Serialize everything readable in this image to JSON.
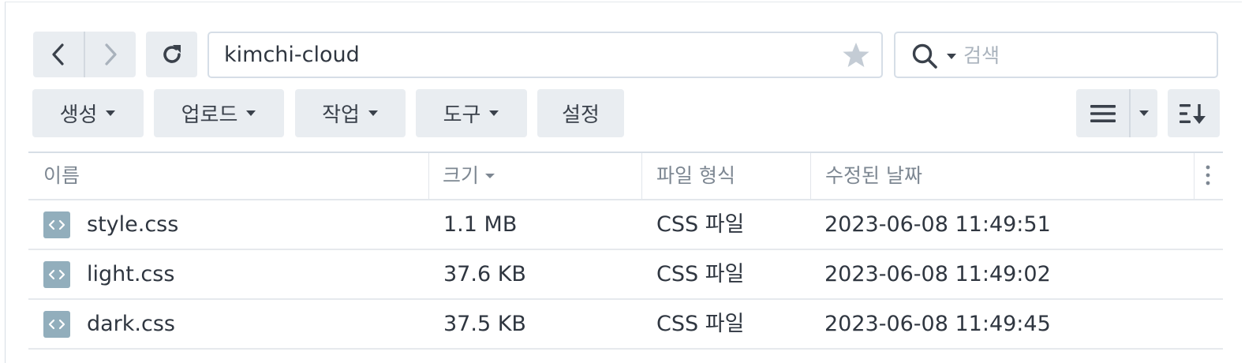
{
  "navigation": {
    "back_icon": "chevron-left-icon",
    "forward_icon": "chevron-right-icon",
    "refresh_icon": "refresh-icon"
  },
  "path_bar": {
    "value": "kimchi-cloud",
    "favorite_icon": "star-icon"
  },
  "search": {
    "placeholder": "검색",
    "icon": "search-icon"
  },
  "toolbar": {
    "create_label": "생성",
    "upload_label": "업로드",
    "action_label": "작업",
    "tools_label": "도구",
    "settings_label": "설정",
    "view_icon": "list-view-icon",
    "sort_icon": "sort-icon"
  },
  "table": {
    "columns": {
      "name": "이름",
      "size": "크기",
      "type": "파일 형식",
      "modified": "수정된 날짜"
    },
    "sorted_by": "size",
    "rows": [
      {
        "name": "style.css",
        "size": "1.1 MB",
        "type": "CSS 파일",
        "modified": "2023-06-08 11:49:51",
        "icon": "code-file-icon"
      },
      {
        "name": "light.css",
        "size": "37.6 KB",
        "type": "CSS 파일",
        "modified": "2023-06-08 11:49:02",
        "icon": "code-file-icon"
      },
      {
        "name": "dark.css",
        "size": "37.5 KB",
        "type": "CSS 파일",
        "modified": "2023-06-08 11:49:45",
        "icon": "code-file-icon"
      }
    ]
  },
  "colors": {
    "button_bg": "#e9edf1",
    "file_icon_bg": "#92aebc",
    "header_text": "#7d8792",
    "body_text": "#2f3640"
  }
}
